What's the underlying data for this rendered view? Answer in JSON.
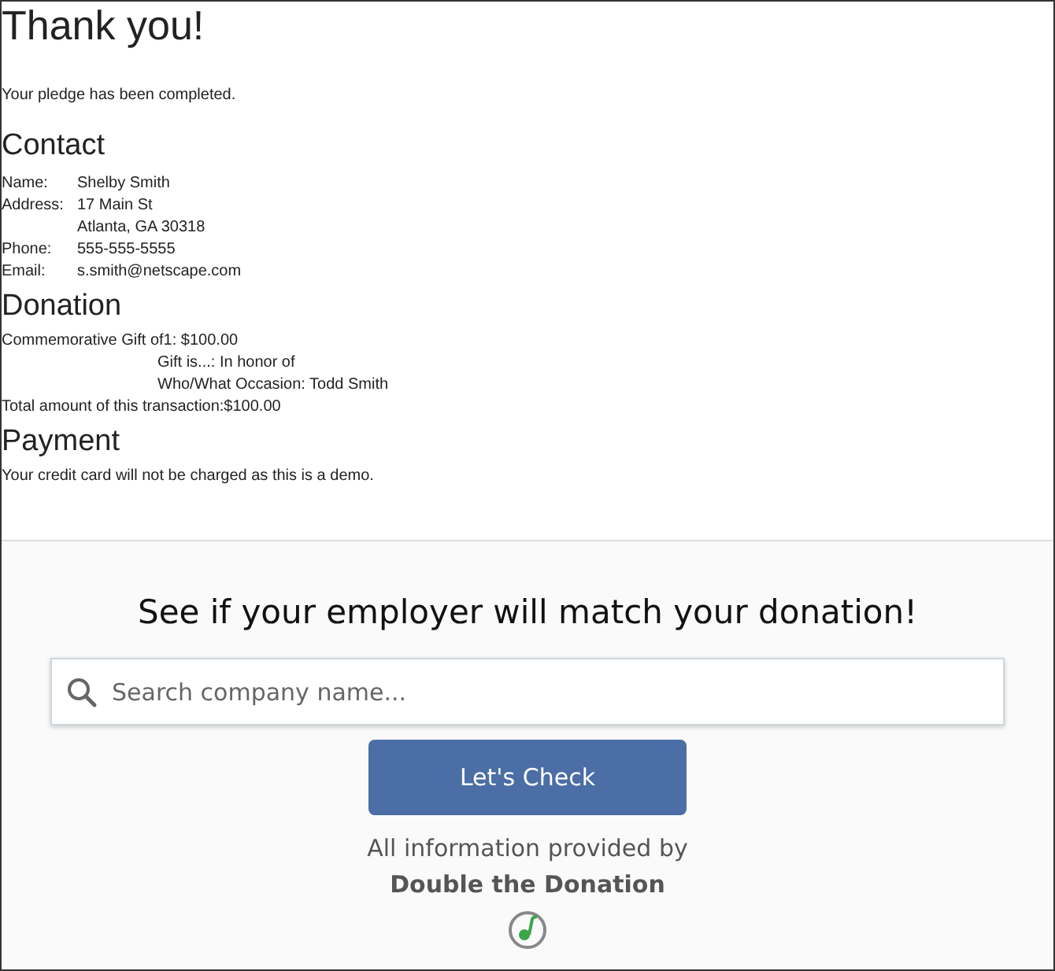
{
  "heading": "Thank you!",
  "message": "Your pledge has been completed.",
  "contact": {
    "title": "Contact",
    "rows": [
      {
        "label": "Name:",
        "values": [
          "Shelby Smith"
        ]
      },
      {
        "label": "Address:",
        "values": [
          "17 Main St",
          "Atlanta, GA 30318"
        ]
      },
      {
        "label": "Phone:",
        "values": [
          "555-555-5555"
        ]
      },
      {
        "label": "Email:",
        "values": [
          "s.smith@netscape.com"
        ]
      }
    ]
  },
  "donation": {
    "title": "Donation",
    "lines": [
      {
        "kind": "main",
        "text": "Commemorative Gift of1: $100.00"
      },
      {
        "kind": "detail",
        "text": "Gift is...: In honor of"
      },
      {
        "kind": "detail",
        "text": "Who/What Occasion: Todd Smith"
      },
      {
        "kind": "main",
        "text": "Total amount of this transaction:$100.00"
      }
    ]
  },
  "payment": {
    "title": "Payment",
    "note": "Your credit card will not be charged as this is a demo."
  },
  "match": {
    "title": "See if your employer will match your donation!",
    "search": {
      "placeholder": "Search company name..."
    },
    "button": "Let's Check",
    "credit": "All information provided by",
    "provider": "Double the Donation"
  }
}
